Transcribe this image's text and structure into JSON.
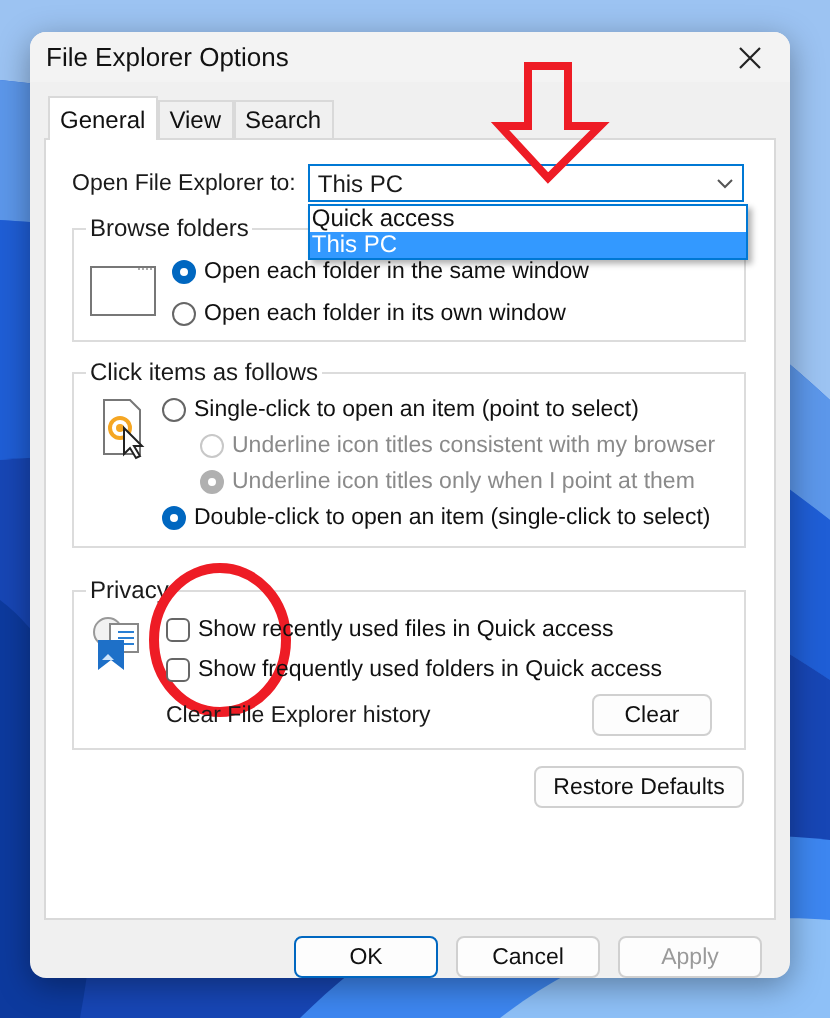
{
  "window": {
    "title": "File Explorer Options"
  },
  "tabs": [
    {
      "label": "General",
      "selected": true
    },
    {
      "label": "View",
      "selected": false
    },
    {
      "label": "Search",
      "selected": false
    }
  ],
  "open_to": {
    "label": "Open File Explorer to:",
    "value": "This PC",
    "expanded": true,
    "options": [
      {
        "label": "Quick access",
        "selected": false
      },
      {
        "label": "This PC",
        "selected": true
      }
    ]
  },
  "browse_folders": {
    "title": "Browse folders",
    "options": [
      {
        "label": "Open each folder in the same window",
        "selected": true,
        "disabled": false
      },
      {
        "label": "Open each folder in its own window",
        "selected": false,
        "disabled": false
      }
    ]
  },
  "click_items": {
    "title": "Click items as follows",
    "options": [
      {
        "kind": "option",
        "label": "Single-click to open an item (point to select)",
        "selected": false,
        "disabled": false
      },
      {
        "kind": "sub-option",
        "label": "Underline icon titles consistent with my browser",
        "selected": false,
        "disabled": true
      },
      {
        "kind": "sub-option",
        "label": "Underline icon titles only when I point at them",
        "selected": true,
        "disabled": true
      },
      {
        "kind": "option",
        "label": "Double-click to open an item (single-click to select)",
        "selected": true,
        "disabled": false
      }
    ]
  },
  "privacy": {
    "title": "Privacy",
    "checkboxes": [
      {
        "label": "Show recently used files in Quick access",
        "checked": false
      },
      {
        "label": "Show frequently used folders in Quick access",
        "checked": false
      }
    ],
    "clear_label": "Clear File Explorer history",
    "clear_button": "Clear"
  },
  "restore_button": "Restore Defaults",
  "buttons": [
    {
      "label": "OK",
      "default": true,
      "disabled": false
    },
    {
      "label": "Cancel",
      "default": false,
      "disabled": false
    },
    {
      "label": "Apply",
      "default": false,
      "disabled": true
    }
  ],
  "annotations": {
    "arrow": {
      "color": "#ee1c25"
    },
    "circle": {
      "color": "#ee1c25"
    }
  }
}
